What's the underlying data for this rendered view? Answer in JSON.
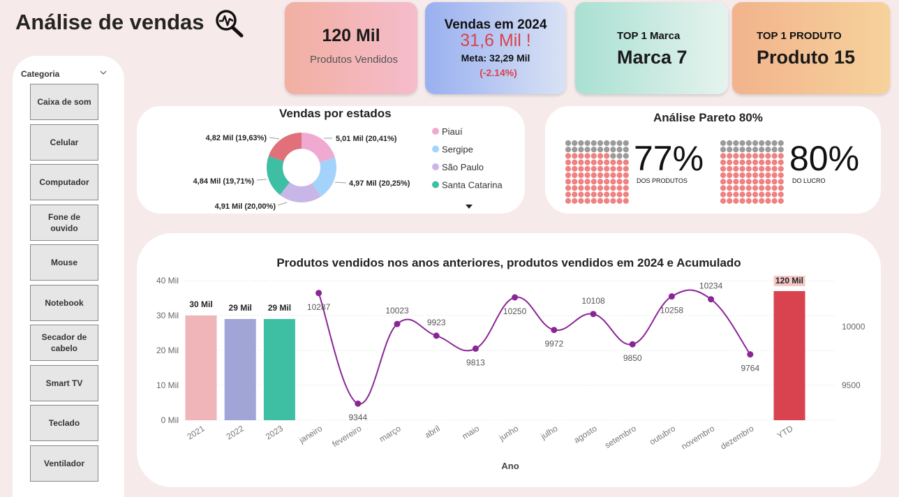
{
  "page": {
    "title": "Análise de vendas"
  },
  "kpis": {
    "produtos": {
      "value": "120 Mil",
      "label": "Produtos Vendidos"
    },
    "vendas": {
      "title": "Vendas em 2024",
      "value": "31,6 Mil",
      "flag": "!",
      "meta": "Meta: 32,29 Mil",
      "variance": "(-2.14%)"
    },
    "marca": {
      "label": "TOP 1 Marca",
      "value": "Marca 7"
    },
    "produto": {
      "label": "TOP 1 PRODUTO",
      "value": "Produto 15"
    }
  },
  "slicer": {
    "header": "Categoria",
    "items": [
      "Caixa de som",
      "Celular",
      "Computador",
      "Fone de ouvido",
      "Mouse",
      "Notebook",
      "Secador de cabelo",
      "Smart TV",
      "Teclado",
      "Ventilador"
    ]
  },
  "states_chart": {
    "title": "Vendas por estados",
    "slices": [
      {
        "state": "Piauí",
        "label": "5,01 Mil (20,41%)",
        "value": 5.01,
        "color": "#f0aad2"
      },
      {
        "state": "Sergipe",
        "label": "4,97 Mil (20,25%)",
        "value": 4.97,
        "color": "#a3d3fb"
      },
      {
        "state": "São Paulo",
        "label": "4,91 Mil (20,00%)",
        "value": 4.91,
        "color": "#c8b6e8"
      },
      {
        "state": "Santa Catarina",
        "label": "4,84 Mil (19,71%)",
        "value": 4.84,
        "color": "#3ebfa4"
      },
      {
        "state": "",
        "label": "4,82 Mil (19,63%)",
        "value": 4.82,
        "color": "#e0707a"
      }
    ],
    "legend": [
      "Piauí",
      "Sergipe",
      "São Paulo",
      "Santa Catarina"
    ]
  },
  "pareto": {
    "title": "Análise Pareto 80%",
    "produtos": {
      "pct": "77%",
      "caption": "DOS PRODUTOS",
      "fraction": 0.77
    },
    "lucro": {
      "pct": "80%",
      "caption": "DO LUCRO",
      "fraction": 0.8
    },
    "colors": {
      "filled": "#ee8282",
      "empty": "#9b9b9b"
    }
  },
  "main_chart_title": "Produtos vendidos nos anos anteriores, produtos vendidos em 2024 e Acumulado",
  "chart_data": {
    "type": "bar+line",
    "title": "Produtos vendidos nos anos anteriores, produtos vendidos em 2024 e Acumulado",
    "xlabel": "Ano",
    "categories": [
      "2021",
      "2022",
      "2023",
      "janeiro",
      "fevereiro",
      "março",
      "abril",
      "maio",
      "junho",
      "julho",
      "agosto",
      "setembro",
      "outubro",
      "novembro",
      "dezembro",
      "YTD"
    ],
    "y_left": {
      "ticks": [
        "0 Mil",
        "10 Mil",
        "20 Mil",
        "30 Mil",
        "40 Mil"
      ],
      "ylim": [
        0,
        40000
      ]
    },
    "y_right": {
      "ticks": [
        "9500",
        "10000"
      ],
      "ylim": [
        9300,
        10400
      ]
    },
    "bars": [
      {
        "category": "2021",
        "value": 30000,
        "label": "30 Mil",
        "color": "#efb5b9"
      },
      {
        "category": "2022",
        "value": 29000,
        "label": "29 Mil",
        "color": "#a0a4d6"
      },
      {
        "category": "2023",
        "value": 29000,
        "label": "29 Mil",
        "color": "#3ebfa4"
      },
      {
        "category": "YTD",
        "value": 120000,
        "label": "120 Mil",
        "color": "#d9424f"
      }
    ],
    "line": {
      "color": "#8a2596",
      "points": [
        {
          "category": "janeiro",
          "value": 10287
        },
        {
          "category": "fevereiro",
          "value": 9344
        },
        {
          "category": "março",
          "value": 10023
        },
        {
          "category": "abril",
          "value": 9923
        },
        {
          "category": "maio",
          "value": 9813
        },
        {
          "category": "junho",
          "value": 10250
        },
        {
          "category": "julho",
          "value": 9972
        },
        {
          "category": "agosto",
          "value": 10108
        },
        {
          "category": "setembro",
          "value": 9850
        },
        {
          "category": "outubro",
          "value": 10258
        },
        {
          "category": "novembro",
          "value": 10234
        },
        {
          "category": "dezembro",
          "value": 9764
        }
      ]
    }
  }
}
